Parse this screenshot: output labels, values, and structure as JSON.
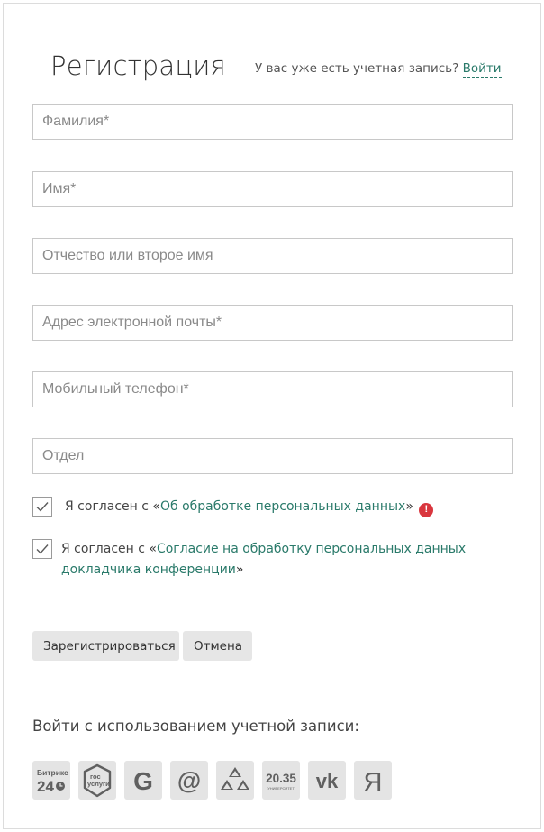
{
  "header": {
    "title": "Регистрация",
    "have_account_text": "У вас уже есть учетная запись?",
    "login_link": "Войти"
  },
  "fields": {
    "last_name": {
      "placeholder": "Фамилия*",
      "value": ""
    },
    "first_name": {
      "placeholder": "Имя*",
      "value": ""
    },
    "middle_name": {
      "placeholder": "Отчество или второе имя",
      "value": ""
    },
    "email": {
      "placeholder": "Адрес электронной почты*",
      "value": ""
    },
    "phone": {
      "placeholder": "Мобильный телефон*",
      "value": ""
    },
    "department": {
      "placeholder": "Отдел",
      "value": ""
    }
  },
  "consents": [
    {
      "prefix": "Я согласен с ",
      "open_quote": "«",
      "link": "Об обработке персональных данных",
      "close_quote": "»",
      "checked": true,
      "has_error": true,
      "error_icon": "!"
    },
    {
      "prefix": "Я согласен с ",
      "open_quote": "«",
      "link_line1": "Согласие на обработку персональных данных",
      "link_line2": "докладчика конференции",
      "close_quote": "»",
      "checked": true,
      "has_error": false
    }
  ],
  "buttons": {
    "register": "Зарегистрироваться",
    "cancel": "Отмена"
  },
  "social": {
    "title": "Войти с использованием учетной записи:",
    "providers": [
      {
        "name": "bitrix24-icon",
        "line1": "Битрикс",
        "line2": "24"
      },
      {
        "name": "gosuslugi-icon",
        "line1": "гос",
        "line2": "услуги"
      },
      {
        "name": "google-icon",
        "glyph": "G"
      },
      {
        "name": "mailru-icon",
        "glyph": "@"
      },
      {
        "name": "odnoklassniki-icon"
      },
      {
        "name": "university2035-icon",
        "line1": "20.35",
        "line2": "УНИВЕРСИТЕТ"
      },
      {
        "name": "vk-icon",
        "glyph": "vk"
      },
      {
        "name": "yandex-icon",
        "glyph": "Я"
      }
    ]
  },
  "colors": {
    "link": "#2a7a6a",
    "error": "#d9363e",
    "button_bg": "#e6e6e6",
    "social_bg": "#e4e4e4"
  }
}
